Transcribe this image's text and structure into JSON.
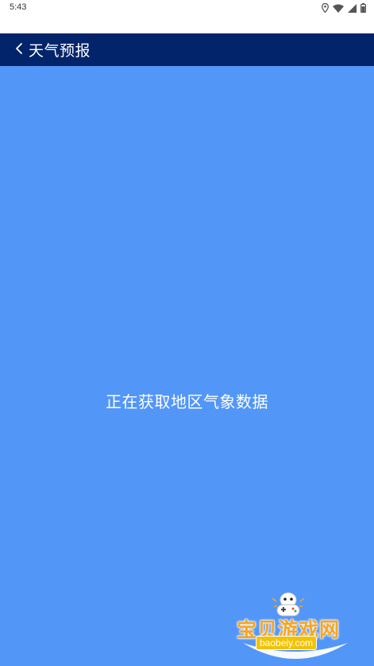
{
  "status_bar": {
    "time": "5:43",
    "icons": [
      "location-icon",
      "wifi-icon",
      "signal-icon",
      "battery-icon"
    ]
  },
  "app_bar": {
    "back_icon": "chevron-left-icon",
    "title": "天气预报"
  },
  "main": {
    "loading_text": "正在获取地区气象数据"
  },
  "watermark": {
    "title": "宝贝游戏网",
    "url": "baobeiy.com"
  },
  "colors": {
    "app_bar": "#02246a",
    "background": "#5296f8",
    "watermark_accent": "#f5a623"
  }
}
